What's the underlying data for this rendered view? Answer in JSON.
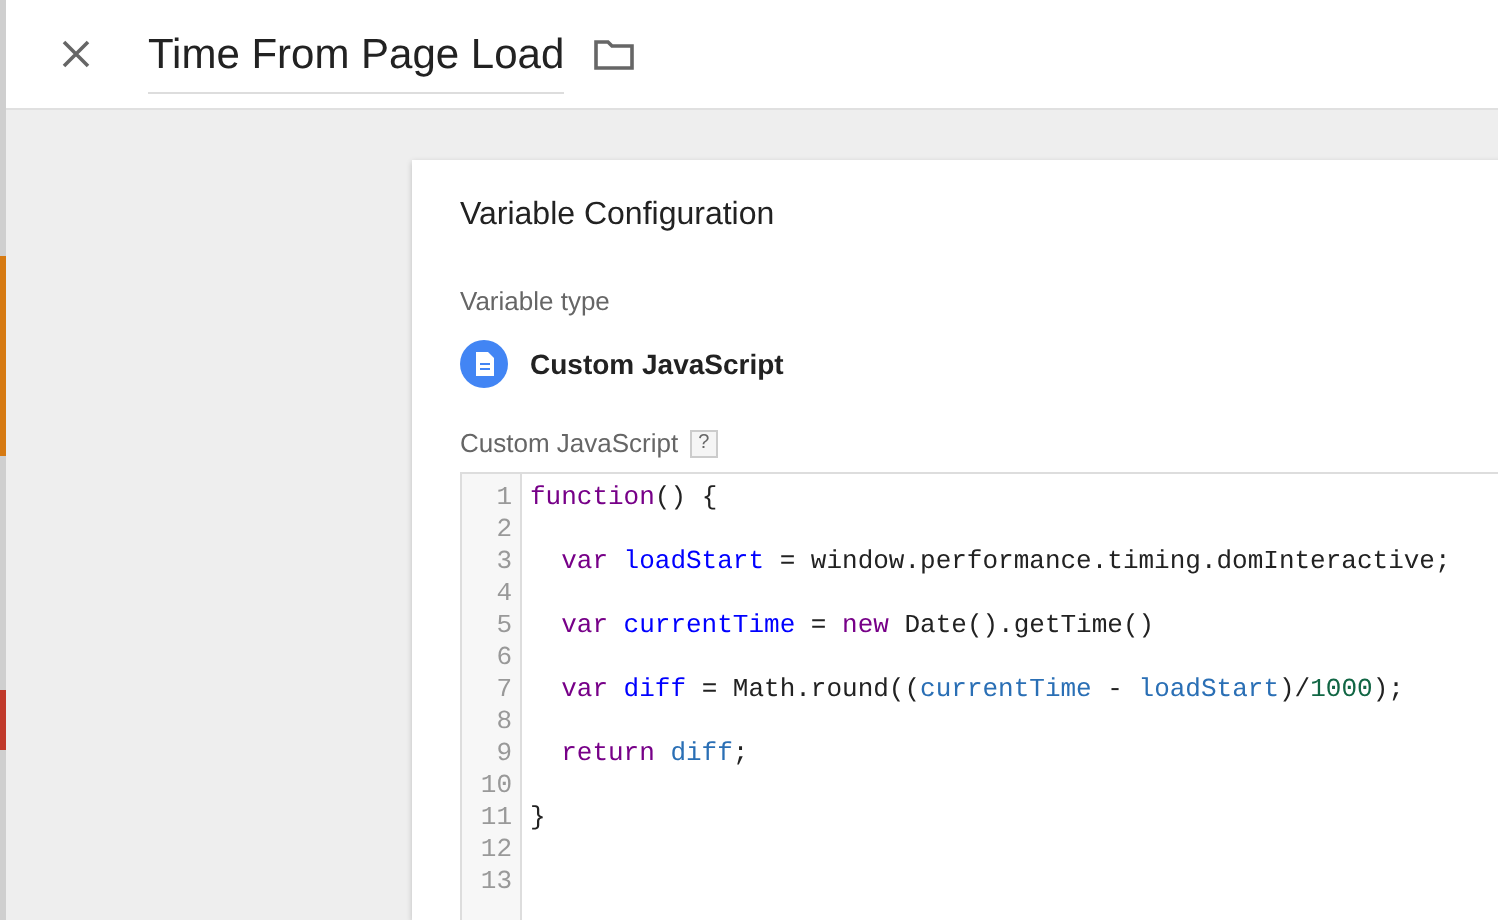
{
  "header": {
    "title": "Time From Page Load"
  },
  "card": {
    "title": "Variable Configuration",
    "type_label": "Variable type",
    "type_name": "Custom JavaScript",
    "code_label": "Custom JavaScript",
    "help": "?"
  },
  "code_lines": [
    {
      "number": "1",
      "tokens": [
        {
          "text": "function",
          "kind": "keyword"
        },
        {
          "text": "() {",
          "kind": "plain"
        }
      ]
    },
    {
      "number": "2"
    },
    {
      "number": "3",
      "indented": true,
      "tokens": [
        {
          "text": "var",
          "kind": "keyword"
        },
        {
          "text": " loadStart",
          "kind": "def"
        },
        {
          "text": " = window.performance.timing.domInteractive;",
          "kind": "plain"
        }
      ]
    },
    {
      "number": "4"
    },
    {
      "number": "5",
      "indented": true,
      "tokens": [
        {
          "text": "var",
          "kind": "keyword"
        },
        {
          "text": " currentTime",
          "kind": "def"
        },
        {
          "text": " = ",
          "kind": "plain"
        },
        {
          "text": "new",
          "kind": "keyword"
        },
        {
          "text": " Date().getTime()",
          "kind": "plain"
        }
      ]
    },
    {
      "number": "6"
    },
    {
      "number": "7",
      "indented": true,
      "tokens": [
        {
          "text": "var",
          "kind": "keyword"
        },
        {
          "text": " diff",
          "kind": "def"
        },
        {
          "text": " = Math.round((",
          "kind": "plain"
        },
        {
          "text": "currentTime",
          "kind": "variable"
        },
        {
          "text": " - ",
          "kind": "plain"
        },
        {
          "text": "loadStart",
          "kind": "variable"
        },
        {
          "text": ")/",
          "kind": "plain"
        },
        {
          "text": "1000",
          "kind": "number"
        },
        {
          "text": ");",
          "kind": "plain"
        }
      ]
    },
    {
      "number": "8"
    },
    {
      "number": "9",
      "indented": true,
      "tokens": [
        {
          "text": "return",
          "kind": "keyword"
        },
        {
          "text": " diff",
          "kind": "variable"
        },
        {
          "text": ";",
          "kind": "plain"
        }
      ]
    },
    {
      "number": "10"
    },
    {
      "number": "11",
      "tokens": [
        {
          "text": "}",
          "kind": "plain"
        }
      ]
    },
    {
      "number": "12"
    },
    {
      "number": "13"
    }
  ]
}
